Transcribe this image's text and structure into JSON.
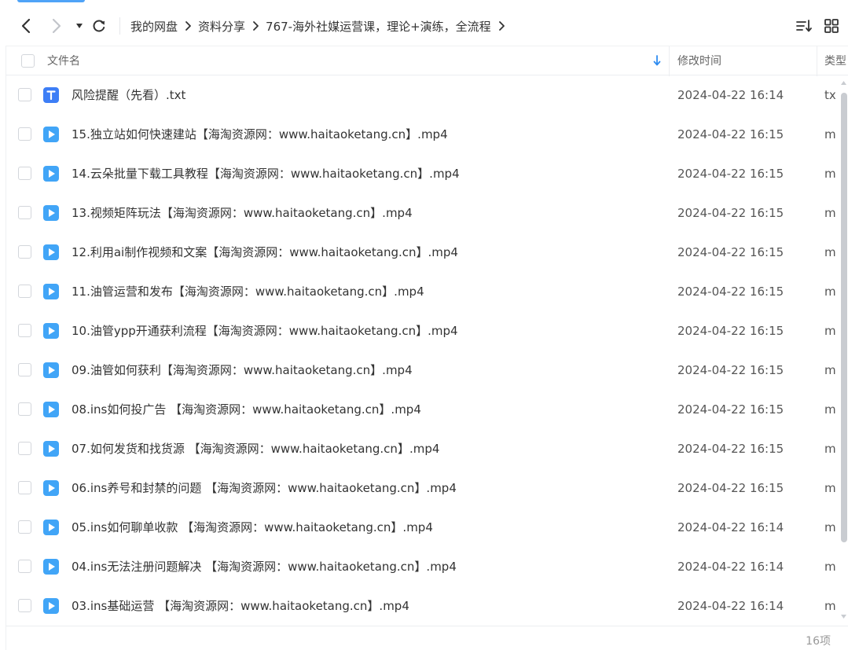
{
  "breadcrumb": [
    "我的网盘",
    "资料分享",
    "767-海外社媒运营课，理论+演练，全流程"
  ],
  "columns": {
    "name": "文件名",
    "modified": "修改时间",
    "type": "类型"
  },
  "files": [
    {
      "name": "风险提醒（先看）.txt",
      "modified": "2024-04-22 16:14",
      "type": "tx",
      "icon": "text-file-icon"
    },
    {
      "name": "15.独立站如何快速建站【海淘资源网：www.haitaoketang.cn】.mp4",
      "modified": "2024-04-22 16:15",
      "type": "m",
      "icon": "video-file-icon"
    },
    {
      "name": "14.云朵批量下载工具教程【海淘资源网：www.haitaoketang.cn】.mp4",
      "modified": "2024-04-22 16:15",
      "type": "m",
      "icon": "video-file-icon"
    },
    {
      "name": "13.视频矩阵玩法【海淘资源网：www.haitaoketang.cn】.mp4",
      "modified": "2024-04-22 16:15",
      "type": "m",
      "icon": "video-file-icon"
    },
    {
      "name": "12.利用ai制作视频和文案【海淘资源网：www.haitaoketang.cn】.mp4",
      "modified": "2024-04-22 16:15",
      "type": "m",
      "icon": "video-file-icon"
    },
    {
      "name": "11.油管运营和发布【海淘资源网：www.haitaoketang.cn】.mp4",
      "modified": "2024-04-22 16:15",
      "type": "m",
      "icon": "video-file-icon"
    },
    {
      "name": "10.油管ypp开通获利流程【海淘资源网：www.haitaoketang.cn】.mp4",
      "modified": "2024-04-22 16:15",
      "type": "m",
      "icon": "video-file-icon"
    },
    {
      "name": "09.油管如何获利【海淘资源网：www.haitaoketang.cn】.mp4",
      "modified": "2024-04-22 16:15",
      "type": "m",
      "icon": "video-file-icon"
    },
    {
      "name": "08.ins如何投广告 【海淘资源网：www.haitaoketang.cn】.mp4",
      "modified": "2024-04-22 16:15",
      "type": "m",
      "icon": "video-file-icon"
    },
    {
      "name": "07.如何发货和找货源 【海淘资源网：www.haitaoketang.cn】.mp4",
      "modified": "2024-04-22 16:15",
      "type": "m",
      "icon": "video-file-icon"
    },
    {
      "name": "06.ins养号和封禁的问题 【海淘资源网：www.haitaoketang.cn】.mp4",
      "modified": "2024-04-22 16:15",
      "type": "m",
      "icon": "video-file-icon"
    },
    {
      "name": "05.ins如何聊单收款 【海淘资源网：www.haitaoketang.cn】.mp4",
      "modified": "2024-04-22 16:14",
      "type": "m",
      "icon": "video-file-icon"
    },
    {
      "name": "04.ins无法注册问题解决 【海淘资源网：www.haitaoketang.cn】.mp4",
      "modified": "2024-04-22 16:14",
      "type": "m",
      "icon": "video-file-icon"
    },
    {
      "name": "03.ins基础运营 【海淘资源网：www.haitaoketang.cn】.mp4",
      "modified": "2024-04-22 16:14",
      "type": "m",
      "icon": "video-file-icon"
    }
  ],
  "footer": {
    "count": "16项"
  },
  "colors": {
    "accent": "#4fa3f7",
    "text_icon": "#3d7ef6",
    "video_icon": "#41a5f7"
  }
}
